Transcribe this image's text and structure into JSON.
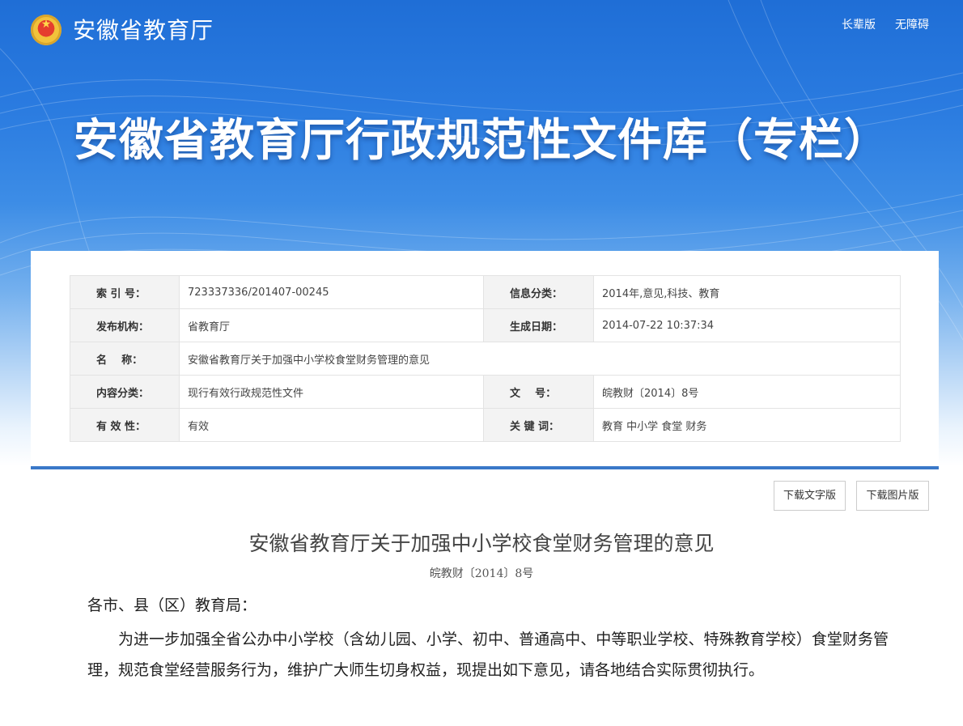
{
  "header": {
    "site_name": "安徽省教育厅",
    "links": [
      "长辈版",
      "无障碍"
    ],
    "banner_title": "安徽省教育厅行政规范性文件库（专栏）"
  },
  "meta": {
    "rows": [
      {
        "k1": "索 引 号：",
        "v1": "723337336/201407-00245",
        "k2": "信息分类：",
        "v2": "2014年,意见,科技、教育"
      },
      {
        "k1": "发布机构：",
        "v1": "省教育厅",
        "k2": "生成日期：",
        "v2": "2014-07-22 10:37:34"
      },
      {
        "k1": "名    称：",
        "v1": "安徽省教育厅关于加强中小学校食堂财务管理的意见"
      },
      {
        "k1": "内容分类：",
        "v1": "现行有效行政规范性文件",
        "k2": "文    号：",
        "v2": "皖教财〔2014〕8号"
      },
      {
        "k1": "有 效 性：",
        "v1": "有效",
        "k2": "关 键 词：",
        "v2": "教育 中小学 食堂 财务"
      }
    ]
  },
  "downloads": {
    "text_version": "下载文字版",
    "image_version": "下载图片版"
  },
  "document": {
    "title": "安徽省教育厅关于加强中小学校食堂财务管理的意见",
    "number": "皖教财〔2014〕8号",
    "salutation": "各市、县（区）教育局：",
    "paragraph": "为进一步加强全省公办中小学校（含幼儿园、小学、初中、普通高中、中等职业学校、特殊教育学校）食堂财务管理，规范食堂经营服务行为，维护广大师生切身权益，现提出如下意见，请各地结合实际贯彻执行。"
  },
  "colors": {
    "banner_blue": "#2a7be0",
    "card_border": "#3a78c8"
  }
}
